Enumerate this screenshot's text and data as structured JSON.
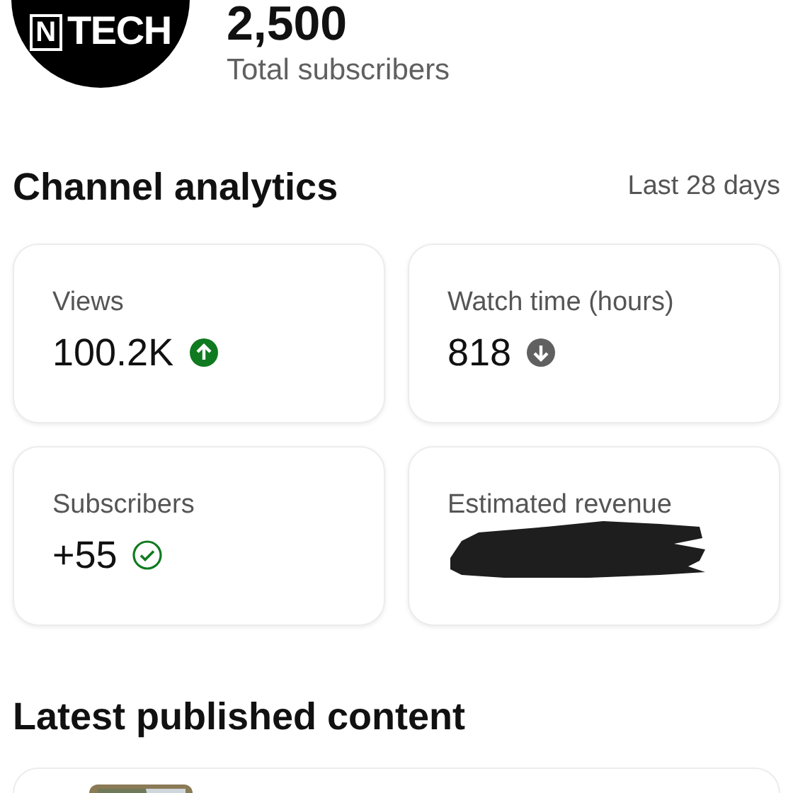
{
  "channel": {
    "logo": {
      "letter": "N",
      "word": "TECH"
    },
    "subscriber_count": "2,500",
    "subscriber_label": "Total subscribers"
  },
  "analytics": {
    "title": "Channel analytics",
    "period": "Last 28 days",
    "metrics": [
      {
        "label": "Views",
        "value": "100.2K",
        "kind": "up"
      },
      {
        "label": "Watch time (hours)",
        "value": "818",
        "kind": "down"
      },
      {
        "label": "Subscribers",
        "value": "+55",
        "kind": "check"
      },
      {
        "label": "Estimated revenue",
        "kind": "redacted"
      }
    ]
  },
  "latest": {
    "title": "Latest published content"
  }
}
